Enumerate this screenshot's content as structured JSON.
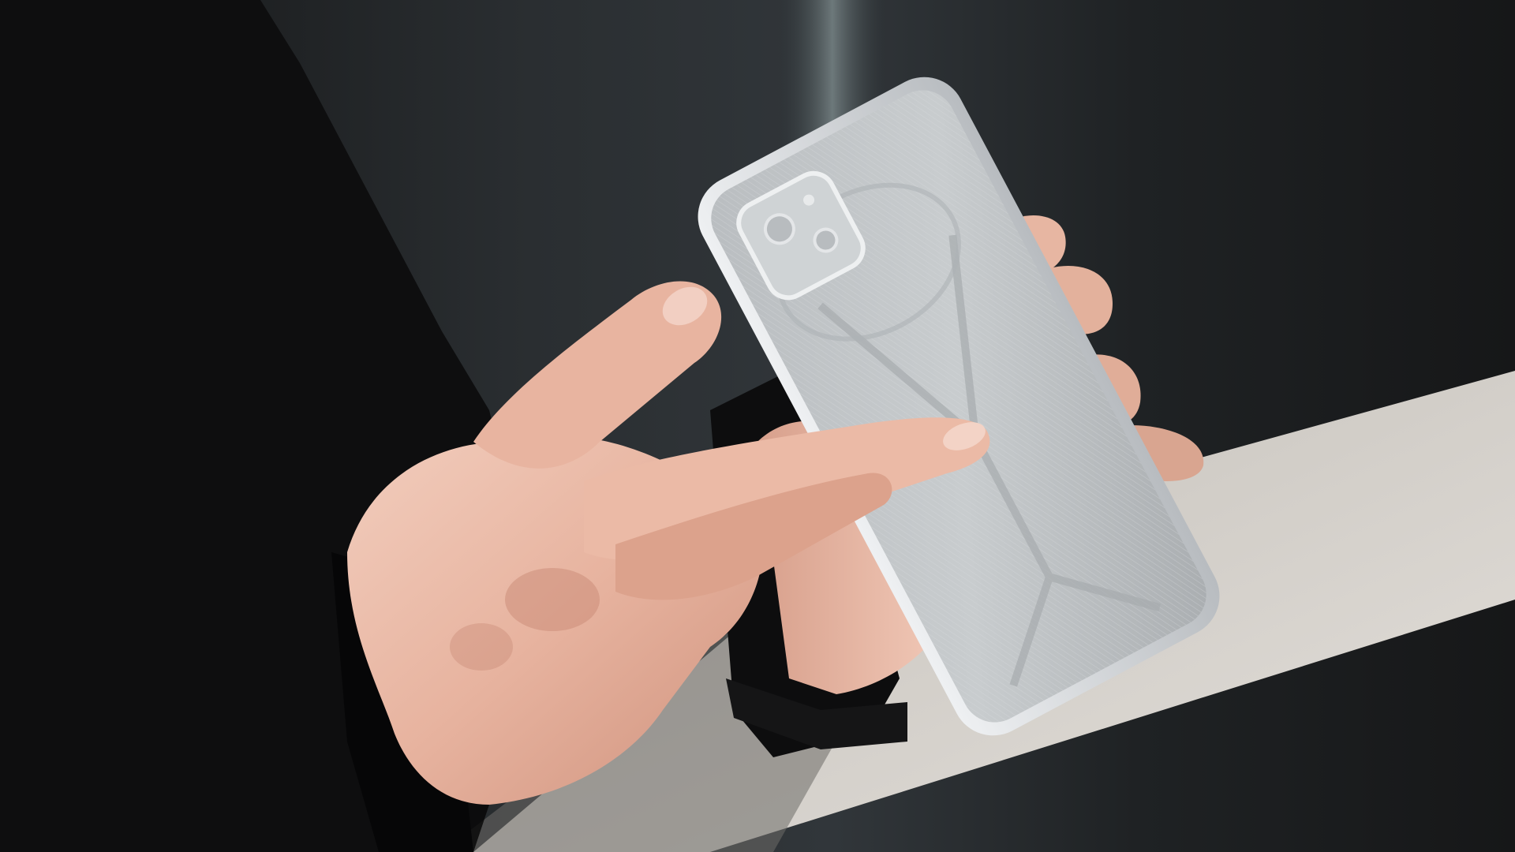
{
  "scene": {
    "subjects": [
      "person",
      "hands",
      "smartphone",
      "table"
    ],
    "colors": {
      "background_dark": "#1d1f21",
      "background_light": "#2f3336",
      "wall_glow": "#6f7b7e",
      "table_top": "#d9d5d0",
      "table_shadow": "#9c9893",
      "sleeve": "#0f0f10",
      "sleeve_shade": "#050505",
      "skin": "#e9b8a4",
      "skin_shadow": "#c98e7a",
      "skin_highlight": "#f4d3c4",
      "phone_frame": "#dcdfe2",
      "phone_back": "#bfc3c6",
      "phone_back_shadow": "#9fa3a6",
      "camera_bump": "#cdd1d3"
    }
  }
}
